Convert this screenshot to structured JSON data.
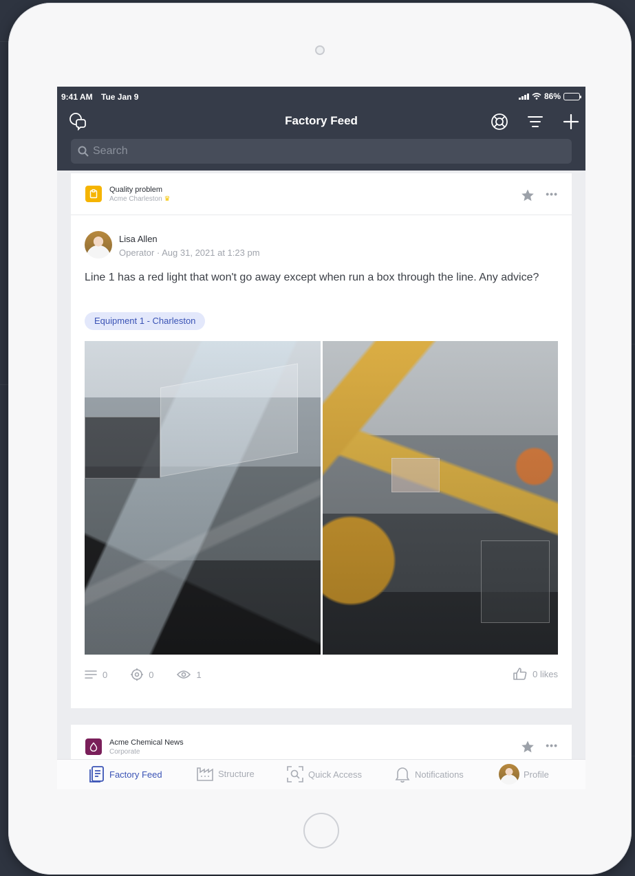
{
  "status_bar": {
    "time": "9:41 AM",
    "date": "Tue Jan 9",
    "battery": "86%",
    "battery_level": 0.86
  },
  "nav": {
    "title": "Factory Feed",
    "icons": [
      "chat-bubbles-icon",
      "lifebuoy-icon",
      "filter-icon",
      "plus-icon"
    ]
  },
  "search": {
    "placeholder": "Search"
  },
  "posts": [
    {
      "category": "Quality problem",
      "location": "Acme Charleston",
      "category_color": "#f5b400",
      "author": "Lisa Allen",
      "meta": "Operator · Aug 31, 2021 at 1:23 pm",
      "text": "Line 1 has a red light that won't go away except when run a box through the line. Any advice?",
      "tag": "Equipment 1 - Charleston",
      "stats": {
        "comments": "0",
        "actions": "0",
        "views": "1",
        "likes": "0 likes"
      }
    },
    {
      "category": "Acme Chemical News",
      "location": "Corporate",
      "category_color": "#7a1f5a"
    }
  ],
  "tabs": [
    {
      "label": "Factory Feed",
      "icon": "feed-icon",
      "active": true
    },
    {
      "label": "Structure",
      "icon": "factory-icon",
      "active": false
    },
    {
      "label": "Quick Access",
      "icon": "scan-icon",
      "active": false
    },
    {
      "label": "Notifications",
      "icon": "bell-icon",
      "active": false
    },
    {
      "label": "Profile",
      "icon": "avatar",
      "active": false
    }
  ],
  "colors": {
    "header_bg": "#363c49",
    "accent": "#3a53b5",
    "tag_bg": "#e3e8fb"
  }
}
